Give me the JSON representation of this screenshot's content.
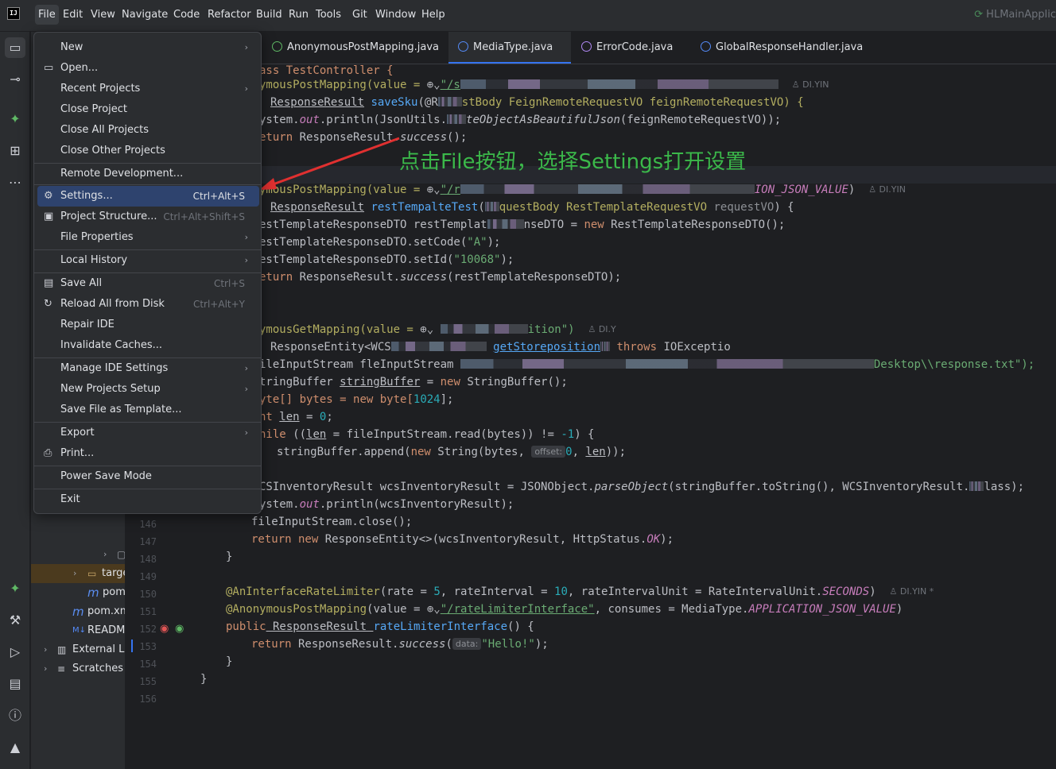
{
  "menubar": {
    "items": [
      "File",
      "Edit",
      "View",
      "Navigate",
      "Code",
      "Refactor",
      "Build",
      "Run",
      "Tools",
      "Git",
      "Window",
      "Help"
    ],
    "project_name": "HLMainApplic"
  },
  "file_menu": {
    "items": [
      {
        "label": "New",
        "shortcut": "",
        "submenu": true,
        "icon": ""
      },
      {
        "label": "Open...",
        "shortcut": "",
        "submenu": false,
        "icon": "folder-icon"
      },
      {
        "label": "Recent Projects",
        "shortcut": "",
        "submenu": true,
        "icon": ""
      },
      {
        "label": "Close Project",
        "shortcut": "",
        "submenu": false,
        "icon": ""
      },
      {
        "label": "Close All Projects",
        "shortcut": "",
        "submenu": false,
        "icon": ""
      },
      {
        "label": "Close Other Projects",
        "shortcut": "",
        "submenu": false,
        "icon": ""
      },
      {
        "label": "Remote Development...",
        "shortcut": "",
        "submenu": false,
        "icon": ""
      },
      {
        "label": "Settings...",
        "shortcut": "Ctrl+Alt+S",
        "submenu": false,
        "icon": "gear-icon",
        "selected": true
      },
      {
        "label": "Project Structure...",
        "shortcut": "Ctrl+Alt+Shift+S",
        "submenu": false,
        "icon": "folder-structure-icon"
      },
      {
        "label": "File Properties",
        "shortcut": "",
        "submenu": true,
        "icon": ""
      },
      {
        "label": "Local History",
        "shortcut": "",
        "submenu": true,
        "icon": ""
      },
      {
        "label": "Save All",
        "shortcut": "Ctrl+S",
        "submenu": false,
        "icon": "save-icon"
      },
      {
        "label": "Reload All from Disk",
        "shortcut": "Ctrl+Alt+Y",
        "submenu": false,
        "icon": "reload-icon"
      },
      {
        "label": "Repair IDE",
        "shortcut": "",
        "submenu": false,
        "icon": ""
      },
      {
        "label": "Invalidate Caches...",
        "shortcut": "",
        "submenu": false,
        "icon": ""
      },
      {
        "label": "Manage IDE Settings",
        "shortcut": "",
        "submenu": true,
        "icon": ""
      },
      {
        "label": "New Projects Setup",
        "shortcut": "",
        "submenu": true,
        "icon": ""
      },
      {
        "label": "Save File as Template...",
        "shortcut": "",
        "submenu": false,
        "icon": ""
      },
      {
        "label": "Export",
        "shortcut": "",
        "submenu": true,
        "icon": ""
      },
      {
        "label": "Print...",
        "shortcut": "",
        "submenu": false,
        "icon": "printer-icon"
      },
      {
        "label": "Power Save Mode",
        "shortcut": "",
        "submenu": false,
        "icon": ""
      },
      {
        "label": "Exit",
        "shortcut": "",
        "submenu": false,
        "icon": ""
      }
    ]
  },
  "tabs": [
    {
      "label": "AnonymousPostMapping.java",
      "icon": "annotation-icon",
      "active": false
    },
    {
      "label": "MediaType.java",
      "icon": "class-icon",
      "active": true
    },
    {
      "label": "ErrorCode.java",
      "icon": "enum-icon",
      "active": false
    },
    {
      "label": "GlobalResponseHandler.java",
      "icon": "class-icon",
      "active": false
    }
  ],
  "project_tree": [
    {
      "label": "targe",
      "icon": "folder-icon",
      "arrow": "›",
      "highlighted": true
    },
    {
      "label": "pom",
      "icon": "maven-icon",
      "arrow": "",
      "highlighted": false
    },
    {
      "label": "pom.xm",
      "icon": "maven-icon",
      "arrow": "",
      "highlighted": false
    },
    {
      "label": "READMI",
      "icon": "markdown-icon",
      "arrow": "",
      "highlighted": false
    },
    {
      "label": "External Lib",
      "icon": "library-icon",
      "arrow": "›",
      "highlighted": false
    },
    {
      "label": "Scratches a",
      "icon": "scratches-icon",
      "arrow": "›",
      "highlighted": false
    }
  ],
  "line_numbers": [
    "146",
    "147",
    "148",
    "149",
    "150",
    "151",
    "152",
    "153",
    "154",
    "155",
    "156"
  ],
  "code": {
    "l1": "ass TestController {",
    "l2a": "ymousPostMapping(value = ",
    "l2b": "\"/s",
    "l3a": "ResponseResult",
    "l3b": "saveSku",
    "l3c": "(@R",
    "l3d": "stBody FeignRemoteRequestVO feignRemoteRequestVO) {",
    "l4a": "ystem.",
    "l4b": "out",
    "l4c": ".println(JsonUtils.",
    "l4d": "teObjectAsBeautifulJson",
    "l4e": "(feignRemoteRequestVO));",
    "l5a": "eturn",
    "l5b": " ResponseResult.",
    "l5c": "success",
    "l5d": "();",
    "l6a": "ymousPostMapping(value = ",
    "l6b": "\"/r",
    "l6c": "ION_JSON_VALUE",
    "l7a": "ResponseResult",
    "l7b": "restTempalteTest",
    "l7c": "questBody RestTemplateRequestVO ",
    "l7d": "requestVO",
    "l7e": ") {",
    "l8a": "estTemplateResponseDTO restTemplat",
    "l8b": "nseDTO = ",
    "l8c": "new",
    "l8d": " RestTemplateResponseDTO();",
    "l9a": "estTemplateResponseDTO.setCode(",
    "l9b": "\"A\"",
    "l9c": ");",
    "l10a": "estTemplateResponseDTO.setId(",
    "l10b": "\"10068\"",
    "l10c": ");",
    "l11a": "eturn",
    "l11b": " ResponseResult.",
    "l11c": "success",
    "l11d": "(restTemplateResponseDTO);",
    "l12a": "ymousGetMapping(value = ",
    "l12b": "ition\")",
    "l13a": "ResponseEntity<WCS",
    "l13b": "getStoreposition",
    "l13c": "throws",
    "l13d": " IOExceptio",
    "l14a": "ileInputStream f",
    "l14b": "leInputStream",
    "l14c": "Desktop\\\\response.txt\");",
    "l15a": "tringBuffer ",
    "l15b": "stringBuffer",
    "l15c": " = ",
    "l15d": "new",
    "l15e": " StringBuffer();",
    "l16a": "yte[] bytes = ",
    "l16b": "new",
    "l16c": " byte[",
    "l16d": "1024",
    "l16e": "];",
    "l17a": "nt ",
    "l17b": "len",
    "l17c": " = ",
    "l17d": "0",
    "l17e": ";",
    "l18a": "hile",
    "l18b": " ((",
    "l18c": "len",
    "l18d": " = fileInputStream.read(bytes)) != ",
    "l18e": "-1",
    "l18f": ") {",
    "l19a": "stringBuffer.append(",
    "l19b": "new",
    "l19c": " String(bytes, ",
    "l19d": "offset:",
    "l19e": "0",
    "l19f": ", ",
    "l19g": "len",
    "l19h": "));",
    "l20a": "CSInventoryResult wcsInventoryResult = JSONObject.",
    "l20b": "parseObject",
    "l20c": "(stringBuffer.toString(), WCSInventoryResult.",
    "l20d": "lass);",
    "l21a": "ystem.",
    "l21b": "out",
    "l21c": ".println(wcsInventoryResult);",
    "l22": "fileInputStream.close();",
    "l23a": "return new",
    "l23b": " ResponseEntity<>(wcsInventoryResult, HttpStatus.",
    "l23c": "OK",
    "l23d": ");",
    "l24": "}",
    "l25a": "@AnInterfaceRateLimiter",
    "l25b": "(rate = ",
    "l25c": "5",
    "l25d": ", rateInterval = ",
    "l25e": "10",
    "l25f": ", rateIntervalUnit = RateIntervalUnit.",
    "l25g": "SECONDS",
    "l25h": ")",
    "l26a": "@AnonymousPostMapping",
    "l26b": "(value = ",
    "l26c": "\"/rateLimiterInterface\"",
    "l26d": ", consumes = MediaType.",
    "l26e": "APPLICATION_JSON_VALUE",
    "l26f": ")",
    "l27a": "public",
    "l27b": " ResponseResult ",
    "l27c": "rateLimiterInterface",
    "l27d": "() {",
    "l28a": "return",
    "l28b": " ResponseResult.",
    "l28c": "success",
    "l28d": "(",
    "l28e": "data:",
    "l28f": "\"Hello!\"",
    "l28g": ");",
    "l29": "}",
    "l30": "}"
  },
  "authors": {
    "a1": "DI.YIN",
    "a2": "DI.YIN",
    "a3": "DI.Y",
    "a4": "DI.YIN *"
  },
  "annotation_text": "点击File按钮，选择Settings打开设置",
  "colors": {
    "accent": "#3574f0",
    "menu_selected": "#2e436e",
    "annotation": "#3bb84a",
    "arrow": "#e03030"
  }
}
